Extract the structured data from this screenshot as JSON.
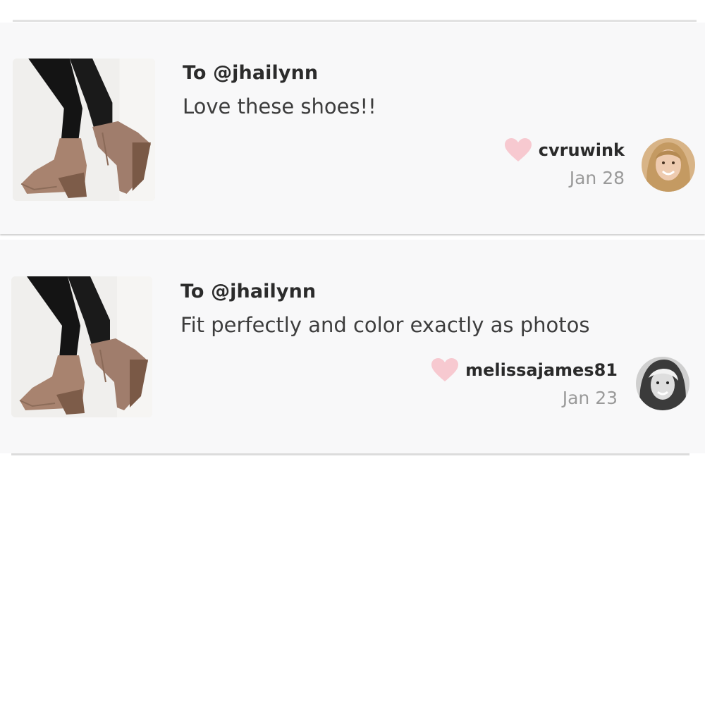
{
  "reviews": [
    {
      "recipient": "To @jhailynn",
      "message": "Love these shoes!!",
      "username": "cvruwink",
      "date": "Jan 28",
      "liked": true
    },
    {
      "recipient": "To @jhailynn",
      "message": "Fit perfectly and color exactly as photos",
      "username": "melissajames81",
      "date": "Jan 23",
      "liked": true
    }
  ],
  "colors": {
    "heart": "#f7c9d0",
    "card_bg": "#f8f8f9",
    "date_text": "#9a9a9a"
  },
  "icons": {
    "like": "heart-icon"
  }
}
